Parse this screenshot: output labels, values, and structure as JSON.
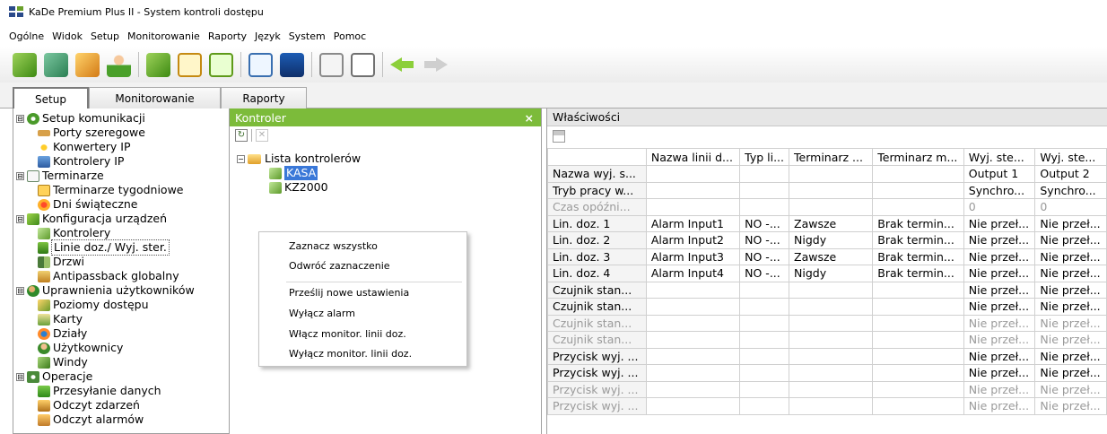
{
  "window": {
    "title": "KaDe Premium Plus II - System kontroli dostępu"
  },
  "menu": [
    "Ogólne",
    "Widok",
    "Setup",
    "Monitorowanie",
    "Raporty",
    "Język",
    "System",
    "Pomoc"
  ],
  "toolbar_icons": [
    "devices-icon",
    "layout-icon",
    "home-icon",
    "user-icon",
    "devices2-icon",
    "document-icon",
    "document2-icon",
    "chart-icon",
    "monitor-icon",
    "search-icon",
    "calendar-icon",
    "back-arrow-icon",
    "forward-arrow-icon"
  ],
  "tabs": [
    {
      "label": "Setup",
      "active": true
    },
    {
      "label": "Monitorowanie",
      "active": false
    },
    {
      "label": "Raporty",
      "active": false
    }
  ],
  "tree": {
    "items": [
      {
        "label": "Setup komunikacji",
        "level": 0,
        "expander": "⊟",
        "icon": "globe-icon"
      },
      {
        "label": "Porty szeregowe",
        "level": 1,
        "icon": "port-icon"
      },
      {
        "label": "Konwertery IP",
        "level": 1,
        "icon": "converter-icon"
      },
      {
        "label": "Kontrolery IP",
        "level": 1,
        "icon": "controller-icon"
      },
      {
        "label": "Terminarze",
        "level": 0,
        "expander": "⊟",
        "icon": "calendar-icon"
      },
      {
        "label": "Terminarze tygodniowe",
        "level": 1,
        "icon": "weekly-calendar-icon"
      },
      {
        "label": "Dni świąteczne",
        "level": 1,
        "icon": "holiday-icon"
      },
      {
        "label": "Konfiguracja urządzeń",
        "level": 0,
        "expander": "⊟",
        "icon": "devices-icon"
      },
      {
        "label": "Kontrolery",
        "level": 1,
        "icon": "controllers-icon"
      },
      {
        "label": "Linie doz./ Wyj. ster.",
        "level": 1,
        "icon": "lines-icon",
        "selected": true
      },
      {
        "label": "Drzwi",
        "level": 1,
        "icon": "door-icon"
      },
      {
        "label": "Antipassback globalny",
        "level": 1,
        "icon": "antipassback-icon"
      },
      {
        "label": "Uprawnienia użytkowników",
        "level": 0,
        "expander": "⊟",
        "icon": "users-icon"
      },
      {
        "label": "Poziomy dostępu",
        "level": 1,
        "icon": "access-level-icon"
      },
      {
        "label": "Karty",
        "level": 1,
        "icon": "card-icon"
      },
      {
        "label": "Działy",
        "level": 1,
        "icon": "department-icon"
      },
      {
        "label": "Użytkownicy",
        "level": 1,
        "icon": "user-icon"
      },
      {
        "label": "Windy",
        "level": 1,
        "icon": "elevator-icon"
      },
      {
        "label": "Operacje",
        "level": 0,
        "expander": "⊟",
        "icon": "operations-icon"
      },
      {
        "label": "Przesyłanie danych",
        "level": 1,
        "icon": "send-data-icon"
      },
      {
        "label": "Odczyt zdarzeń",
        "level": 1,
        "icon": "read-events-icon"
      },
      {
        "label": "Odczyt alarmów",
        "level": 1,
        "icon": "read-alarms-icon"
      }
    ]
  },
  "kontroler_panel": {
    "title": "Kontroler",
    "close": "×",
    "tree_root": "Lista kontrolerów",
    "controllers": [
      "KASA",
      "KZ2000"
    ]
  },
  "context_menu": [
    "Zaznacz wszystko",
    "Odwróć zaznaczenie",
    "Prześlij nowe ustawienia",
    "Wyłącz alarm",
    "Włącz monitor. linii doz.",
    "Wyłącz monitor. linii doz."
  ],
  "properties": {
    "title": "Właściwości",
    "columns": [
      "",
      "Nazwa linii d...",
      "Typ li...",
      "Terminarz ...",
      "Terminarz m...",
      "Wyj. ste...",
      "Wyj. ste..."
    ],
    "rows": [
      {
        "cells": [
          "Nazwa wyj. s...",
          "",
          "",
          "",
          "",
          "Output 1",
          "Output 2"
        ],
        "dim": false
      },
      {
        "cells": [
          "Tryb pracy w...",
          "",
          "",
          "",
          "",
          "Synchro...",
          "Synchro..."
        ],
        "dim": false
      },
      {
        "cells": [
          "Czas opóźni...",
          "",
          "",
          "",
          "",
          "0",
          "0"
        ],
        "dim": true
      },
      {
        "cells": [
          "Lin. doz. 1",
          "Alarm Input1",
          "NO -...",
          "Zawsze",
          "Brak termin...",
          "Nie przeł...",
          "Nie przeł..."
        ],
        "dim": false
      },
      {
        "cells": [
          "Lin. doz. 2",
          "Alarm Input2",
          "NO -...",
          "Nigdy",
          "Brak termin...",
          "Nie przeł...",
          "Nie przeł..."
        ],
        "dim": false
      },
      {
        "cells": [
          "Lin. doz. 3",
          "Alarm Input3",
          "NO -...",
          "Zawsze",
          "Brak termin...",
          "Nie przeł...",
          "Nie przeł..."
        ],
        "dim": false
      },
      {
        "cells": [
          "Lin. doz. 4",
          "Alarm Input4",
          "NO -...",
          "Nigdy",
          "Brak termin...",
          "Nie przeł...",
          "Nie przeł..."
        ],
        "dim": false
      },
      {
        "cells": [
          "Czujnik stan...",
          "",
          "",
          "",
          "",
          "Nie przeł...",
          "Nie przeł..."
        ],
        "dim": false
      },
      {
        "cells": [
          "Czujnik stan...",
          "",
          "",
          "",
          "",
          "Nie przeł...",
          "Nie przeł..."
        ],
        "dim": false
      },
      {
        "cells": [
          "Czujnik stan...",
          "",
          "",
          "",
          "",
          "Nie przeł...",
          "Nie przeł..."
        ],
        "dim": true
      },
      {
        "cells": [
          "Czujnik stan...",
          "",
          "",
          "",
          "",
          "Nie przeł...",
          "Nie przeł..."
        ],
        "dim": true
      },
      {
        "cells": [
          "Przycisk wyj. ...",
          "",
          "",
          "",
          "",
          "Nie przeł...",
          "Nie przeł..."
        ],
        "dim": false
      },
      {
        "cells": [
          "Przycisk wyj. ...",
          "",
          "",
          "",
          "",
          "Nie przeł...",
          "Nie przeł..."
        ],
        "dim": false
      },
      {
        "cells": [
          "Przycisk wyj. ...",
          "",
          "",
          "",
          "",
          "Nie przeł...",
          "Nie przeł..."
        ],
        "dim": true
      },
      {
        "cells": [
          "Przycisk wyj. ...",
          "",
          "",
          "",
          "",
          "Nie przeł...",
          "Nie przeł..."
        ],
        "dim": true
      }
    ]
  },
  "colors": {
    "panel_header": "#7cbb3a",
    "selection": "#3a78d8"
  }
}
